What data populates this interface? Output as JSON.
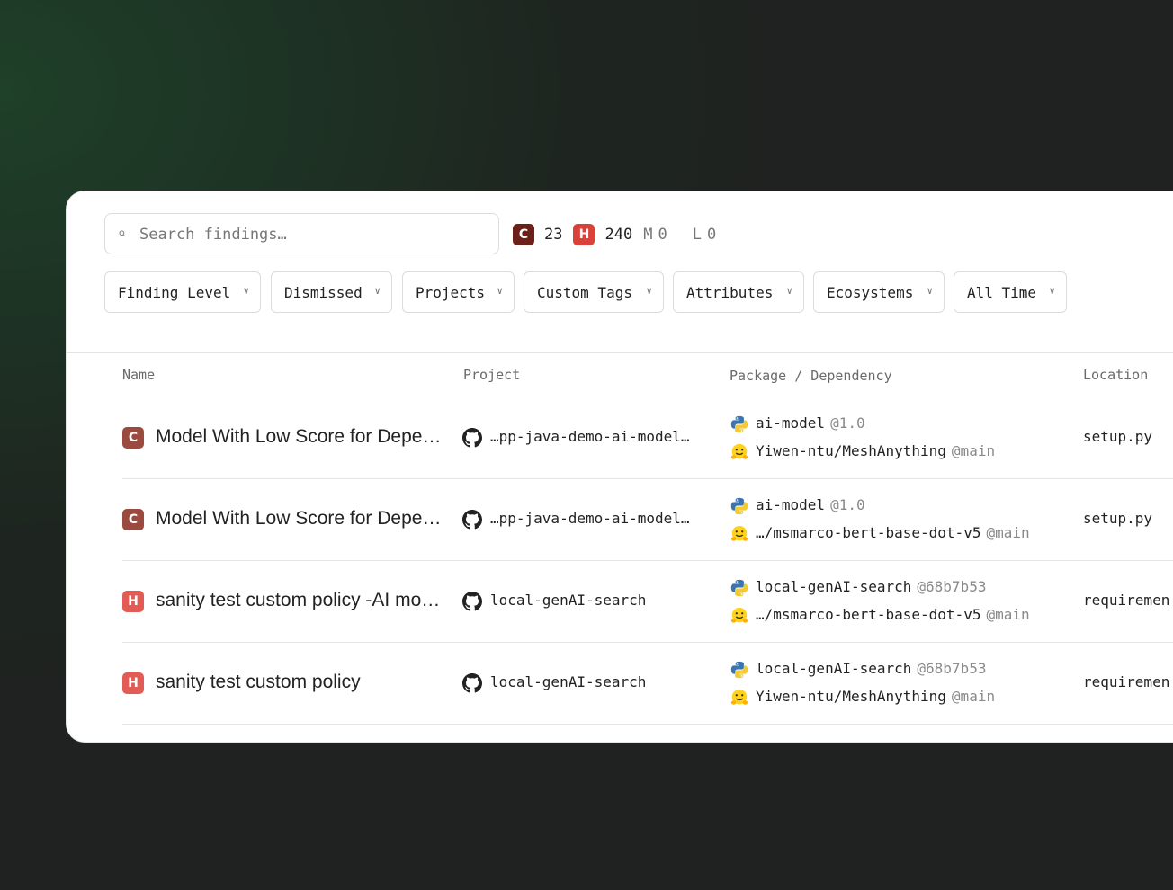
{
  "search": {
    "placeholder": "Search findings…"
  },
  "counts": {
    "c_label": "C",
    "c": "23",
    "h_label": "H",
    "h": "240",
    "m_label": "M",
    "m": "0",
    "l_label": "L",
    "l": "0"
  },
  "filters": [
    {
      "label": "Finding Level"
    },
    {
      "label": "Dismissed"
    },
    {
      "label": "Projects"
    },
    {
      "label": "Custom Tags"
    },
    {
      "label": "Attributes"
    },
    {
      "label": "Ecosystems"
    },
    {
      "label": "All Time"
    }
  ],
  "table": {
    "headers": {
      "name": "Name",
      "project": "Project",
      "package": "Package / Dependency",
      "location": "Location"
    },
    "rows": [
      {
        "level": "C",
        "name": "Model With Low Score for Depe…",
        "project": "…pp-java-demo-ai-model…",
        "pkg": "ai-model",
        "pkg_ver": "@1.0",
        "dep": "Yiwen-ntu/MeshAnything",
        "dep_ver": "@main",
        "location": "setup.py"
      },
      {
        "level": "C",
        "name": "Model With Low Score for Depe…",
        "project": "…pp-java-demo-ai-model…",
        "pkg": "ai-model",
        "pkg_ver": "@1.0",
        "dep": "…/msmarco-bert-base-dot-v5",
        "dep_ver": "@main",
        "location": "setup.py"
      },
      {
        "level": "H",
        "name": "sanity test custom policy -AI mo…",
        "project": "local-genAI-search",
        "pkg": "local-genAI-search",
        "pkg_ver": "@68b7b53",
        "dep": "…/msmarco-bert-base-dot-v5",
        "dep_ver": "@main",
        "location": "requiremen"
      },
      {
        "level": "H",
        "name": "sanity test custom policy",
        "project": "local-genAI-search",
        "pkg": "local-genAI-search",
        "pkg_ver": "@68b7b53",
        "dep": "Yiwen-ntu/MeshAnything",
        "dep_ver": "@main",
        "location": "requiremen"
      }
    ]
  },
  "colors": {
    "critical": "#9a4a3e",
    "high": "#e25c55",
    "critical_count_badge": "#6b2019",
    "high_count_badge": "#d9413a"
  },
  "icons": {
    "search": "search-icon",
    "chevron": "chevron-down-icon",
    "project": "github-icon",
    "package": "python-icon",
    "dependency": "huggingface-icon"
  }
}
